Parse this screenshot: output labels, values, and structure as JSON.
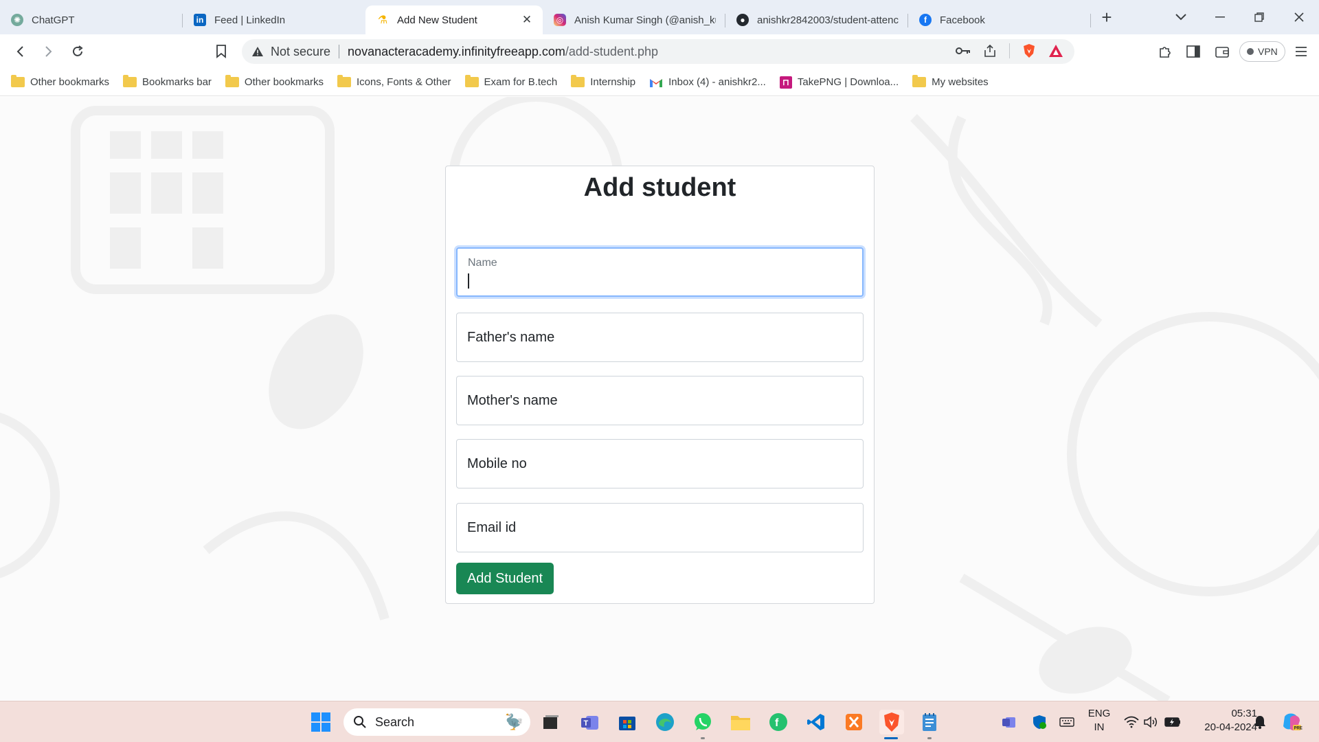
{
  "tabs": [
    {
      "title": "ChatGPT",
      "icon": "chatgpt-icon",
      "color": "#74aa9c"
    },
    {
      "title": "Feed | LinkedIn",
      "icon": "linkedin-icon",
      "color": "#0a66c2"
    },
    {
      "title": "Add New Student",
      "icon": "academy-icon",
      "color": "#f5b400",
      "active": true
    },
    {
      "title": "Anish Kumar Singh (@anish_ku",
      "icon": "instagram-icon",
      "color": "#d62976"
    },
    {
      "title": "anishkr2842003/student-attenc",
      "icon": "github-icon",
      "color": "#24292f"
    },
    {
      "title": "Facebook",
      "icon": "facebook-icon",
      "color": "#1877f2"
    }
  ],
  "address": {
    "security": "Not secure",
    "domain": "novanacteracademy.infinityfreeapp.com",
    "path": "/add-student.php"
  },
  "vpn_label": "VPN",
  "bookmarks": [
    {
      "label": "Other bookmarks",
      "type": "folder"
    },
    {
      "label": "Bookmarks bar",
      "type": "folder"
    },
    {
      "label": "Other bookmarks",
      "type": "folder"
    },
    {
      "label": "Icons, Fonts & Other",
      "type": "folder"
    },
    {
      "label": "Exam for B.tech",
      "type": "folder"
    },
    {
      "label": "Internship",
      "type": "folder"
    },
    {
      "label": "Inbox (4) - anishkr2...",
      "type": "gmail"
    },
    {
      "label": "TakePNG | Downloa...",
      "type": "takepng"
    },
    {
      "label": "My websites",
      "type": "folder"
    }
  ],
  "form": {
    "title": "Add student",
    "fields": [
      {
        "placeholder": "Name",
        "focused": true
      },
      {
        "placeholder": "Father's name"
      },
      {
        "placeholder": "Mother's name"
      },
      {
        "placeholder": "Mobile no"
      },
      {
        "placeholder": "Email id"
      }
    ],
    "submit_label": "Add Student",
    "submit_color": "#198754"
  },
  "taskbar": {
    "search_label": "Search",
    "language": "ENG",
    "region": "IN",
    "time": "05:31",
    "date": "20-04-2024"
  }
}
